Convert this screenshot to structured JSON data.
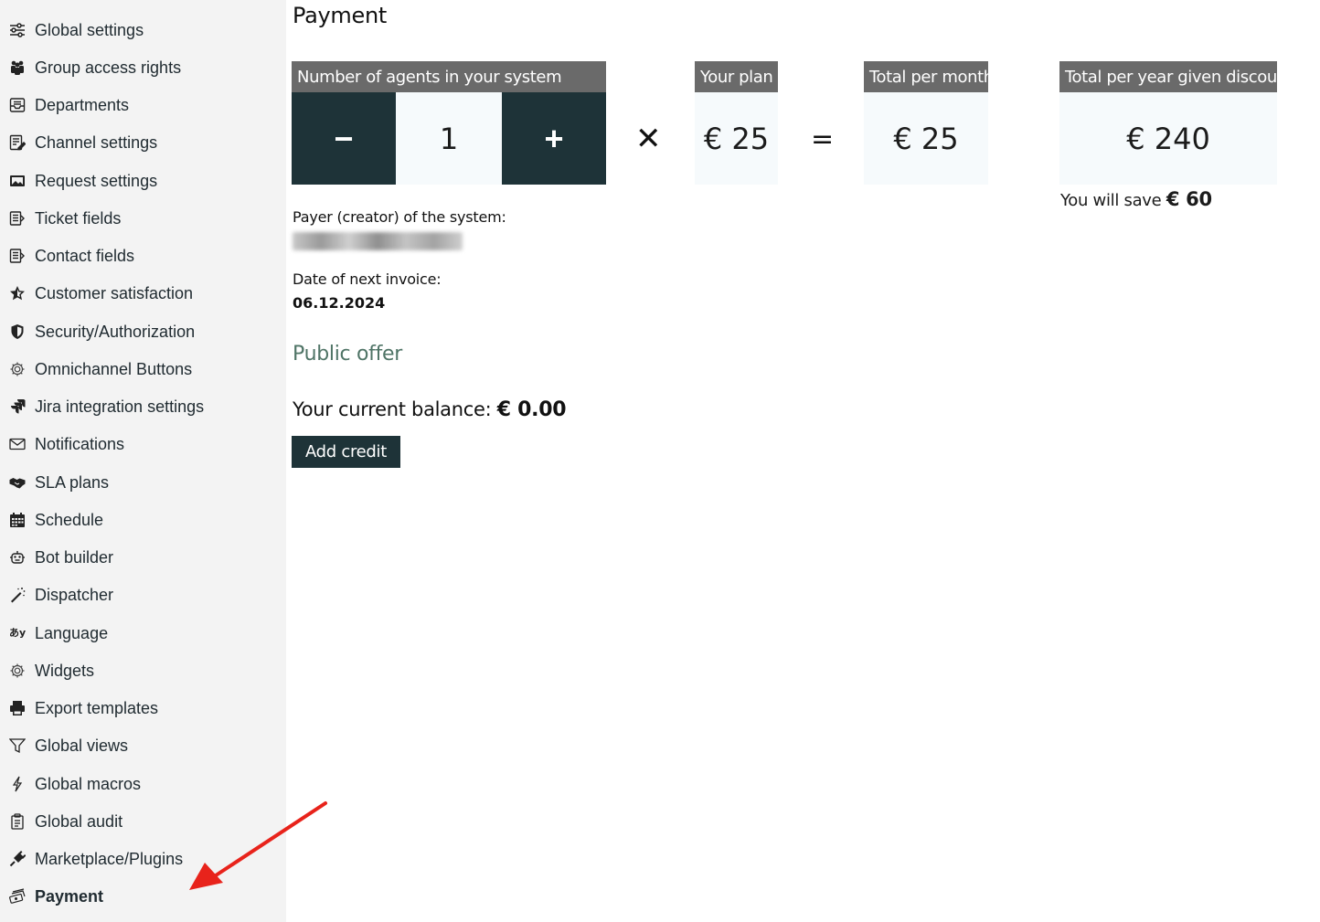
{
  "sidebar": {
    "items": [
      {
        "label": "Global settings",
        "icon": "sliders-icon"
      },
      {
        "label": "Group access rights",
        "icon": "users-icon"
      },
      {
        "label": "Departments",
        "icon": "inbox-icon"
      },
      {
        "label": "Channel settings",
        "icon": "edit-list-icon"
      },
      {
        "label": "Request settings",
        "icon": "image-icon"
      },
      {
        "label": "Ticket fields",
        "icon": "form-icon"
      },
      {
        "label": "Contact fields",
        "icon": "form-icon"
      },
      {
        "label": "Customer satisfaction",
        "icon": "star-icon"
      },
      {
        "label": "Security/Authorization",
        "icon": "shield-icon"
      },
      {
        "label": "Omnichannel Buttons",
        "icon": "gear-icon"
      },
      {
        "label": "Jira integration settings",
        "icon": "jira-icon"
      },
      {
        "label": "Notifications",
        "icon": "envelope-icon"
      },
      {
        "label": "SLA plans",
        "icon": "handshake-icon"
      },
      {
        "label": "Schedule",
        "icon": "calendar-icon"
      },
      {
        "label": "Bot builder",
        "icon": "robot-icon"
      },
      {
        "label": "Dispatcher",
        "icon": "magic-wand-icon"
      },
      {
        "label": "Language",
        "icon": "language-icon"
      },
      {
        "label": "Widgets",
        "icon": "gear-icon"
      },
      {
        "label": "Export templates",
        "icon": "printer-icon"
      },
      {
        "label": "Global views",
        "icon": "filter-icon"
      },
      {
        "label": "Global macros",
        "icon": "bolt-icon"
      },
      {
        "label": "Global audit",
        "icon": "clipboard-icon"
      },
      {
        "label": "Marketplace/Plugins",
        "icon": "plug-icon"
      },
      {
        "label": "Payment",
        "icon": "money-icon",
        "active": true
      }
    ]
  },
  "main": {
    "title": "Payment",
    "agents": {
      "header": "Number of agents in your system",
      "minus": "−",
      "value": "1",
      "plus": "+"
    },
    "multiply": "✕",
    "plan": {
      "header": "Your plan",
      "value": "€ 25"
    },
    "equals": "=",
    "month": {
      "header": "Total per month",
      "value": "€ 25"
    },
    "year": {
      "header": "Total per year given discount",
      "value": "€ 240"
    },
    "save": {
      "prefix": "You will save",
      "amount": "€ 60"
    },
    "payer_label": "Payer (creator) of the system:",
    "next_invoice_label": "Date of next invoice:",
    "next_invoice_date": "06.12.2024",
    "public_offer": "Public offer",
    "balance": {
      "prefix": "Your current balance:",
      "amount": "€ 0.00"
    },
    "add_credit": "Add credit"
  },
  "colors": {
    "dark_button": "#1e3338",
    "header_gray": "#6a6a6a",
    "link_green": "#4f7466",
    "arrow_red": "#e8231b"
  }
}
